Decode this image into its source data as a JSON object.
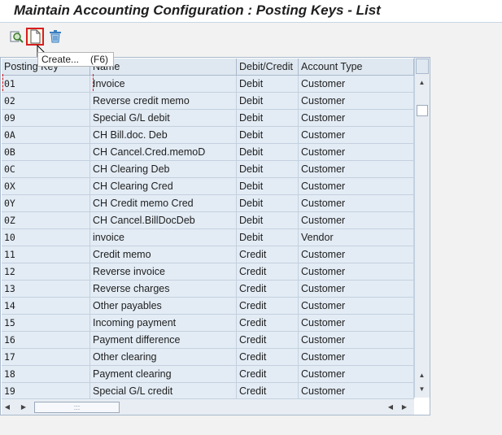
{
  "window": {
    "title": "Maintain Accounting Configuration : Posting Keys - List"
  },
  "toolbar": {
    "buttons": [
      {
        "name": "details",
        "icon": "glasses-details-icon"
      },
      {
        "name": "create",
        "icon": "new-document-icon"
      },
      {
        "name": "delete",
        "icon": "trash-icon"
      }
    ],
    "tooltip": {
      "label": "Create...",
      "shortcut": "(F6)"
    }
  },
  "table": {
    "columns": [
      "Posting Key",
      "Name",
      "Debit/Credit",
      "Account Type"
    ],
    "rows": [
      {
        "key": "01",
        "name": "Invoice",
        "dc": "Debit",
        "acct": "Customer"
      },
      {
        "key": "02",
        "name": "Reverse credit memo",
        "dc": "Debit",
        "acct": "Customer"
      },
      {
        "key": "09",
        "name": "Special G/L debit",
        "dc": "Debit",
        "acct": "Customer"
      },
      {
        "key": "0A",
        "name": "CH Bill.doc. Deb",
        "dc": "Debit",
        "acct": "Customer"
      },
      {
        "key": "0B",
        "name": "CH Cancel.Cred.memoD",
        "dc": "Debit",
        "acct": "Customer"
      },
      {
        "key": "0C",
        "name": "CH Clearing Deb",
        "dc": "Debit",
        "acct": "Customer"
      },
      {
        "key": "0X",
        "name": "CH Clearing Cred",
        "dc": "Debit",
        "acct": "Customer"
      },
      {
        "key": "0Y",
        "name": "CH Credit memo Cred",
        "dc": "Debit",
        "acct": "Customer"
      },
      {
        "key": "0Z",
        "name": "CH Cancel.BillDocDeb",
        "dc": "Debit",
        "acct": "Customer"
      },
      {
        "key": "10",
        "name": "invoice",
        "dc": "Debit",
        "acct": "Vendor"
      },
      {
        "key": "11",
        "name": "Credit memo",
        "dc": "Credit",
        "acct": "Customer"
      },
      {
        "key": "12",
        "name": "Reverse invoice",
        "dc": "Credit",
        "acct": "Customer"
      },
      {
        "key": "13",
        "name": "Reverse charges",
        "dc": "Credit",
        "acct": "Customer"
      },
      {
        "key": "14",
        "name": "Other payables",
        "dc": "Credit",
        "acct": "Customer"
      },
      {
        "key": "15",
        "name": "Incoming payment",
        "dc": "Credit",
        "acct": "Customer"
      },
      {
        "key": "16",
        "name": "Payment difference",
        "dc": "Credit",
        "acct": "Customer"
      },
      {
        "key": "17",
        "name": "Other clearing",
        "dc": "Credit",
        "acct": "Customer"
      },
      {
        "key": "18",
        "name": "Payment clearing",
        "dc": "Credit",
        "acct": "Customer"
      },
      {
        "key": "19",
        "name": "Special G/L credit",
        "dc": "Credit",
        "acct": "Customer"
      }
    ]
  },
  "colors": {
    "row_bg": "#e3ecf5",
    "header_bg": "#dfe8f1",
    "focus": "#d81e1e"
  }
}
